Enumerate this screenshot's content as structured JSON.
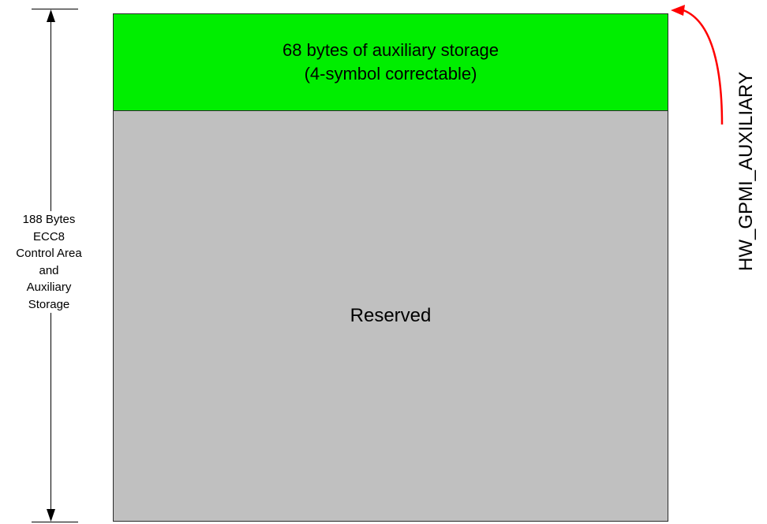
{
  "dimension": {
    "label_lines": [
      "188 Bytes",
      "ECC8",
      "Control Area",
      "and",
      "Auxiliary",
      "Storage"
    ]
  },
  "auxiliary_block": {
    "line1": "68 bytes of auxiliary storage",
    "line2": "(4-symbol correctable)",
    "fill_color": "#00ee00"
  },
  "reserved_block": {
    "label": "Reserved",
    "fill_color": "#c0c0c0"
  },
  "register": {
    "label": "HW_GPMI_AUXILIARY",
    "arrow_color": "#ff0000"
  }
}
